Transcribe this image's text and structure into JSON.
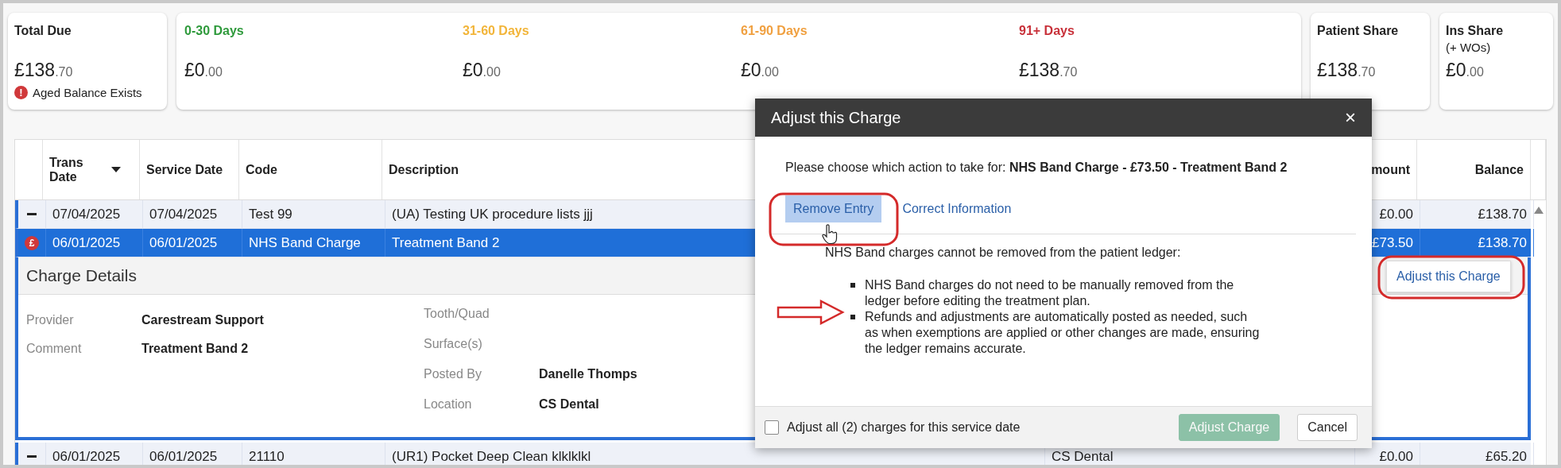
{
  "summary": {
    "total_due": {
      "label": "Total Due",
      "amount": "£138",
      "cents": ".70",
      "warning": "Aged Balance Exists",
      "warning_glyph": "!"
    },
    "aging": [
      {
        "label": "0-30 Days",
        "color": "#2f9a3c",
        "amount": "£0",
        "cents": ".00"
      },
      {
        "label": "31-60 Days",
        "color": "#f2b53a",
        "amount": "£0",
        "cents": ".00"
      },
      {
        "label": "61-90 Days",
        "color": "#f0a040",
        "amount": "£0",
        "cents": ".00"
      },
      {
        "label": "91+ Days",
        "color": "#c8313a",
        "amount": "£138",
        "cents": ".70"
      }
    ],
    "shares": [
      {
        "label": "Patient Share",
        "amount": "£138",
        "cents": ".70"
      },
      {
        "label": "Ins Share",
        "sublabel": "(+ WOs)",
        "amount": "£0",
        "cents": ".00"
      }
    ]
  },
  "table": {
    "columns": [
      {
        "label": "Trans Date",
        "sorted": true
      },
      {
        "label": "Service Date",
        "sorted": false
      },
      {
        "label": "Code",
        "sorted": false
      },
      {
        "label": "Description",
        "sorted": false
      },
      {
        "label": "mount",
        "sorted": false
      },
      {
        "label": "Balance",
        "sorted": false
      }
    ],
    "rows": [
      {
        "marker": {
          "kind": "collapse"
        },
        "trans_date": "07/04/2025",
        "service_date": "07/04/2025",
        "code": "Test 99",
        "description": "(UA) Testing UK procedure lists jjj",
        "amount": "£0.00",
        "balance": "£138.70",
        "selected": false,
        "expanded": false
      },
      {
        "marker": {
          "kind": "alert",
          "glyph": "£"
        },
        "trans_date": "06/01/2025",
        "service_date": "06/01/2025",
        "code": "NHS Band Charge",
        "description": "Treatment Band 2",
        "amount": "£73.50",
        "balance": "£138.70",
        "selected": true,
        "expanded": true
      },
      {
        "marker": {
          "kind": "collapse"
        },
        "trans_date": "06/01/2025",
        "service_date": "06/01/2025",
        "code": "21110",
        "description": "(UR1) Pocket Deep Clean klklklkl",
        "column_6": "CS Dental",
        "amount": "£0.00",
        "balance": "£65.20",
        "selected": false,
        "expanded": false
      }
    ],
    "details": {
      "title": "Charge Details",
      "left": [
        {
          "label": "Provider",
          "value": "Carestream Support"
        },
        {
          "label": "Comment",
          "value": "Treatment Band 2"
        }
      ],
      "right": [
        {
          "label": "Tooth/Quad"
        },
        {
          "label": "Surface(s)"
        },
        {
          "label": "Posted By",
          "value": "Danelle Thomps"
        },
        {
          "label": "Location",
          "value": "CS Dental"
        }
      ]
    }
  },
  "popover": {
    "link": "Adjust this Charge"
  },
  "dialog": {
    "title": "Adjust this Charge",
    "close": "×",
    "prompt": "Please choose which action to take for:  **NHS Band Charge - £73.50 - Treatment Band 2**",
    "actions": [
      {
        "label": "Remove Entry",
        "selected": true
      },
      {
        "label": "Correct Information",
        "selected": false
      }
    ],
    "notice": "NHS Band charges cannot be removed from the patient ledger:",
    "bullets": [
      "NHS Band charges do not need to be manually removed from the ledger before editing the treatment plan.",
      "Refunds and adjustments are automatically posted as needed, such as when exemptions are applied or other changes are made, ensuring the ledger remains accurate."
    ],
    "checkbox": {
      "label": "Adjust all (2) charges for this service date",
      "checked": false
    },
    "buttons": [
      {
        "label": "Adjust Charge",
        "kind": "primary",
        "disabled": true
      },
      {
        "label": "Cancel",
        "kind": "secondary",
        "disabled": false
      }
    ]
  }
}
